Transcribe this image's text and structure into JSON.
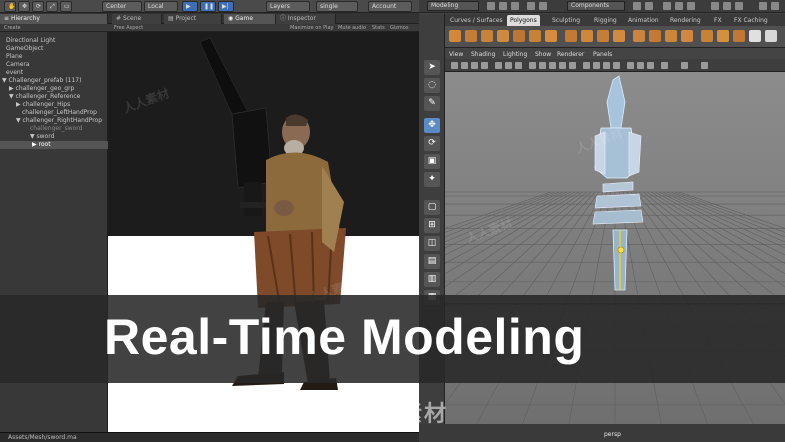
{
  "unity": {
    "toolbar": {
      "center": "Center",
      "local": "Local",
      "layers": "Layers",
      "layout": "single",
      "account": "Account"
    },
    "tabs": {
      "hierarchy": "Hierarchy",
      "scene": "Scene",
      "project": "Project",
      "game": "Game",
      "inspector": "Inspector"
    },
    "subbar": {
      "create": "Create",
      "free_aspect": "Free Aspect",
      "maximize": "Maximize on Play",
      "mute": "Mute audio",
      "stats": "Stats",
      "gizmos": "Gizmos"
    },
    "hierarchy_items": [
      {
        "label": "Directional Light"
      },
      {
        "label": "GameObject"
      },
      {
        "label": "Plane"
      },
      {
        "label": "Camera"
      },
      {
        "label": "event"
      },
      {
        "label": "▼ Challenger_prefab (117)"
      },
      {
        "label": "▶ challenger_geo_grp"
      },
      {
        "label": "▼ challenger_Reference"
      },
      {
        "label": "▶ challenger_Hips"
      },
      {
        "label": "challenger_LeftHandProp"
      },
      {
        "label": "▼ challenger_RightHandProp"
      },
      {
        "label": "challenger_sword"
      },
      {
        "label": "▼ sword"
      },
      {
        "label": "▶ root"
      }
    ],
    "status_path": "Assets/Mesh/sword.ma"
  },
  "maya": {
    "mode": "Modeling",
    "components": "Components",
    "shelf_tabs": [
      "Curves / Surfaces",
      "Polygons",
      "Sculpting",
      "Rigging",
      "Animation",
      "Rendering",
      "FX",
      "FX Caching"
    ],
    "active_shelf_tab": "Polygons",
    "panel_menus": [
      "View",
      "Shading",
      "Lighting",
      "Show",
      "Renderer",
      "Panels"
    ],
    "camera_label": "persp"
  },
  "overlay": {
    "title": "Real-Time Modeling",
    "watermark": "人人素材"
  },
  "colors": {
    "unity_play": "#3d6fb6",
    "maya_selected_tool": "#5a8bc7",
    "shelf_active_tab": "#dddddd",
    "title_text": "#ffffff"
  }
}
